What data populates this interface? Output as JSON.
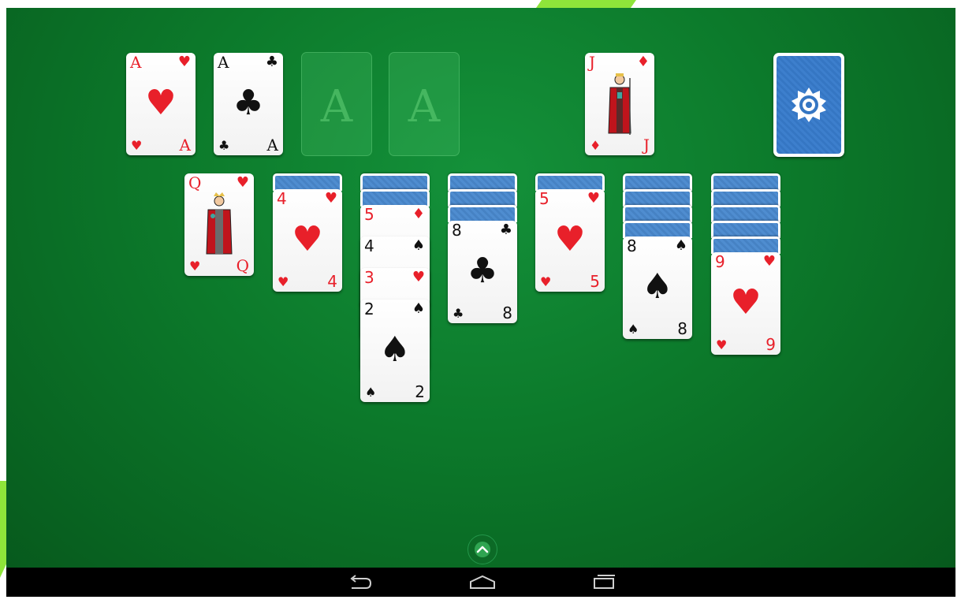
{
  "foundations": [
    {
      "rank": "A",
      "suit": "♥",
      "color": "red"
    },
    {
      "rank": "A",
      "suit": "♣",
      "color": "black"
    },
    {
      "empty_label": "A"
    },
    {
      "empty_label": "A"
    }
  ],
  "waste": {
    "rank": "J",
    "suit": "♦",
    "color": "red"
  },
  "tableau": [
    {
      "face_down": 0,
      "cards": [
        {
          "rank": "Q",
          "suit": "♥",
          "color": "red"
        }
      ]
    },
    {
      "face_down": 1,
      "cards": [
        {
          "rank": "4",
          "suit": "♥",
          "color": "red"
        }
      ]
    },
    {
      "face_down": 2,
      "cards": [
        {
          "rank": "5",
          "suit": "♦",
          "color": "red"
        },
        {
          "rank": "4",
          "suit": "♠",
          "color": "black"
        },
        {
          "rank": "3",
          "suit": "♥",
          "color": "red"
        },
        {
          "rank": "2",
          "suit": "♠",
          "color": "black"
        }
      ]
    },
    {
      "face_down": 3,
      "cards": [
        {
          "rank": "8",
          "suit": "♣",
          "color": "black"
        }
      ]
    },
    {
      "face_down": 1,
      "cards": [
        {
          "rank": "5",
          "suit": "♥",
          "color": "red"
        }
      ]
    },
    {
      "face_down": 4,
      "cards": [
        {
          "rank": "8",
          "suit": "♠",
          "color": "black"
        }
      ]
    },
    {
      "face_down": 5,
      "cards": [
        {
          "rank": "9",
          "suit": "♥",
          "color": "red"
        }
      ]
    }
  ],
  "stock": {
    "icon": "card-back-emblem-icon"
  },
  "controls": {
    "menu_icon": "chevron-up-icon"
  },
  "nav": {
    "back_icon": "back-icon",
    "home_icon": "home-icon",
    "recents_icon": "recents-icon"
  },
  "colors": {
    "felt": "#0c7a2b",
    "card_back": "#4a86c9",
    "red_suit": "#e8202a",
    "black_suit": "#111111"
  }
}
